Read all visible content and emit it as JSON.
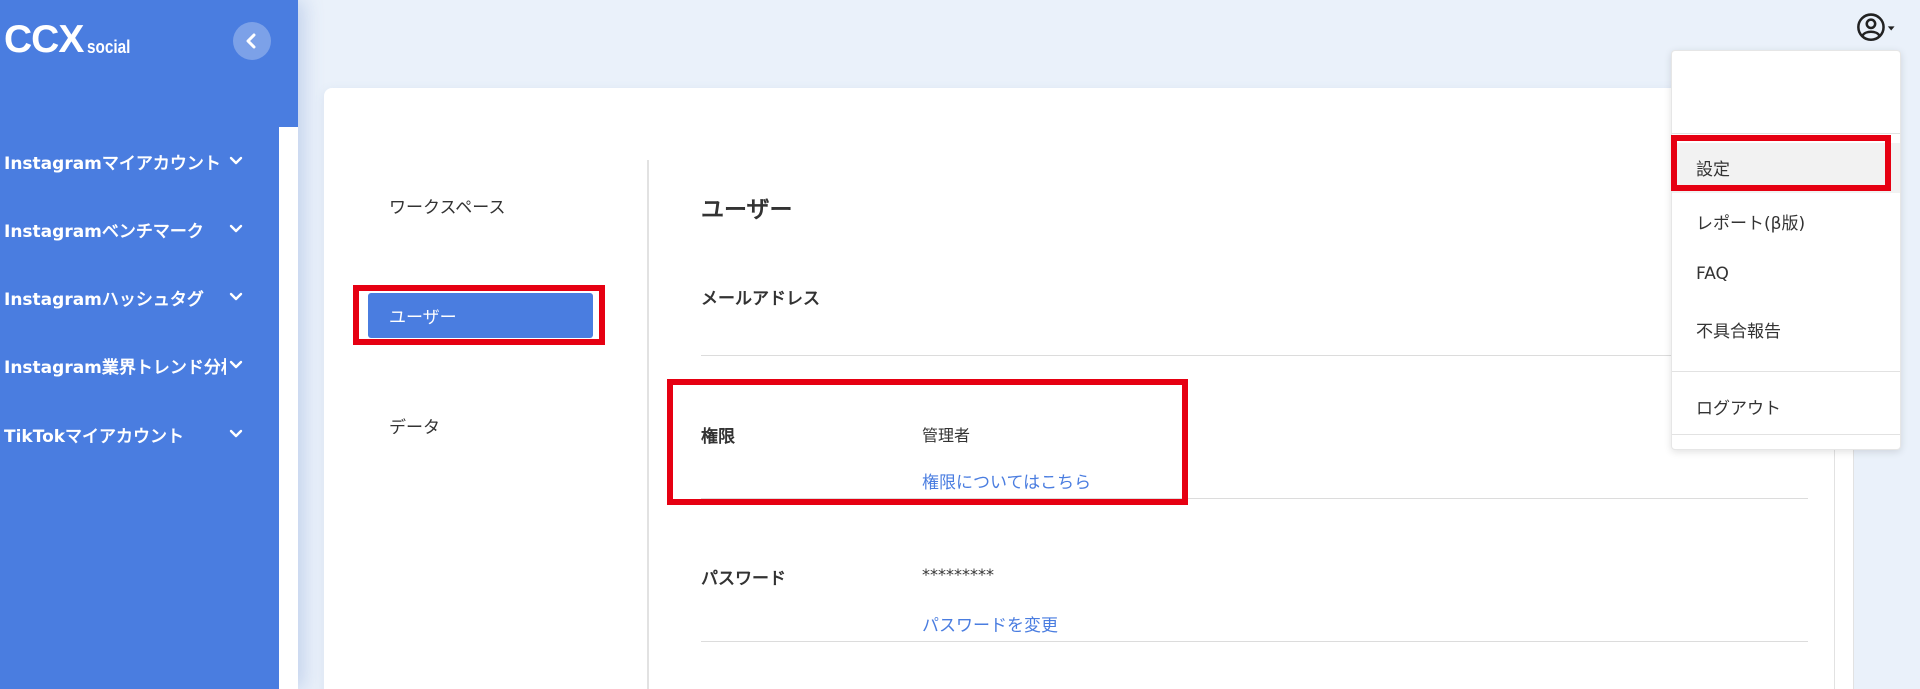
{
  "app": {
    "logo_main": "CCX",
    "logo_sub": "social"
  },
  "sidebar": {
    "items": [
      {
        "label": "Instagramマイアカウント"
      },
      {
        "label": "Instagramベンチマーク"
      },
      {
        "label": "Instagramハッシュタグ"
      },
      {
        "label": "Instagram業界トレンド分析"
      },
      {
        "label": "TikTokマイアカウント"
      }
    ]
  },
  "settings_nav": {
    "items": [
      {
        "label": "ワークスペース"
      },
      {
        "label": "ユーザー"
      },
      {
        "label": "データ"
      }
    ],
    "active": "ユーザー"
  },
  "user_page": {
    "title": "ユーザー",
    "email_label": "メールアドレス",
    "role_label": "権限",
    "role_value": "管理者",
    "role_link": "権限についてはこちら",
    "password_label": "パスワード",
    "password_value": "*********",
    "password_link": "パスワードを変更"
  },
  "user_menu": {
    "items": [
      {
        "label": "設定"
      },
      {
        "label": "レポート(β版)"
      },
      {
        "label": "FAQ"
      },
      {
        "label": "不具合報告"
      },
      {
        "label": "ログアウト"
      }
    ]
  },
  "colors": {
    "accent": "#4a7de0",
    "highlight": "#e60012",
    "background": "#eaf1fa"
  }
}
